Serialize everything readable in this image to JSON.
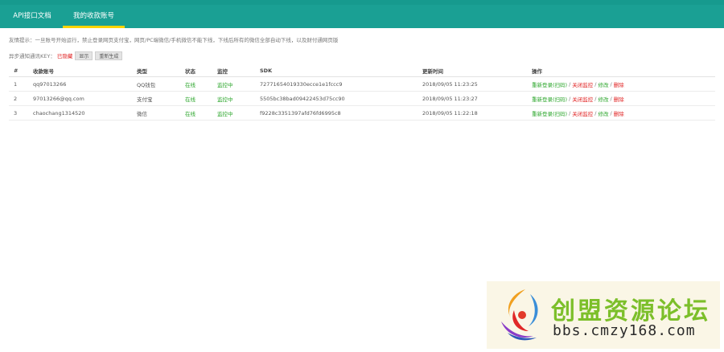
{
  "tabs": [
    {
      "label": "API接口文档",
      "active": false
    },
    {
      "label": "我的收款账号",
      "active": true
    }
  ],
  "notice": "友情提示：一旦账号开始运行，禁止登录网页支付宝，网页/PC端微信/手机微信不能下线，下线后所有的微信全部自动下线，以及财付通网页版",
  "async_key": {
    "label": "异步通知通讯KEY：",
    "status": "已隐藏",
    "show_button": "显示",
    "regenerate_button": "重新生成"
  },
  "table": {
    "headers": {
      "idx": "#",
      "account": "收款账号",
      "type": "类型",
      "state": "状态",
      "monitor": "监控",
      "sdk": "SDK",
      "updated": "更新时间",
      "ops": "操作"
    },
    "rows": [
      {
        "idx": "1",
        "account": "qq97013266",
        "type": "QQ钱包",
        "state": "在线",
        "monitor": "监控中",
        "sdk": "72771654019330ecce1e1fccc9",
        "updated": "2018/09/05 11:23:25"
      },
      {
        "idx": "2",
        "account": "97013266@qq.com",
        "type": "支付宝",
        "state": "在线",
        "monitor": "监控中",
        "sdk": "5505bc38bad09422453d75cc90",
        "updated": "2018/09/05 11:23:27"
      },
      {
        "idx": "3",
        "account": "chaochang1314520",
        "type": "微信",
        "state": "在线",
        "monitor": "监控中",
        "sdk": "f9228c3351397afd76fd6995c8",
        "updated": "2018/09/05 11:22:18"
      }
    ],
    "ops": {
      "relogin": "重新登录(扫码)",
      "close_monitor": "关闭监控",
      "edit": "修改",
      "delete": "删除",
      "separator": "/"
    }
  },
  "watermark": {
    "title": "创盟资源论坛",
    "url": "bbs.cmzy168.com"
  },
  "colors": {
    "header": "#1aa094",
    "tab_underline": "#ffd400",
    "online": "#2aa52a",
    "danger": "#e02020",
    "watermark_text": "#7cbf2a"
  }
}
